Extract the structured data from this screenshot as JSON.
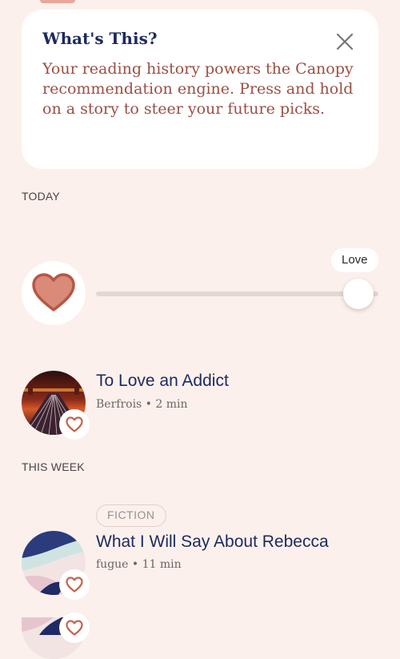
{
  "info_card": {
    "title": "What's This?",
    "body": "Your reading history powers the Canopy recommendation engine. Press and hold on a story to steer your future picks."
  },
  "sections": {
    "today_label": "TODAY",
    "this_week_label": "THIS WEEK"
  },
  "sentiment_slider": {
    "tooltip": "Love",
    "level": 0.93
  },
  "stories": [
    {
      "title": "To Love an Addict",
      "meta": "Berfrois • 2 min"
    },
    {
      "genre": "FICTION",
      "title": "What I Will Say About Rebecca",
      "meta": "fugue • 11 min"
    }
  ],
  "colors": {
    "background": "#fbf0ec",
    "title_navy": "#1d2a5e",
    "body_rust": "#9b4f43",
    "heart_fill": "#d98a79",
    "heart_stroke": "#b85643"
  }
}
